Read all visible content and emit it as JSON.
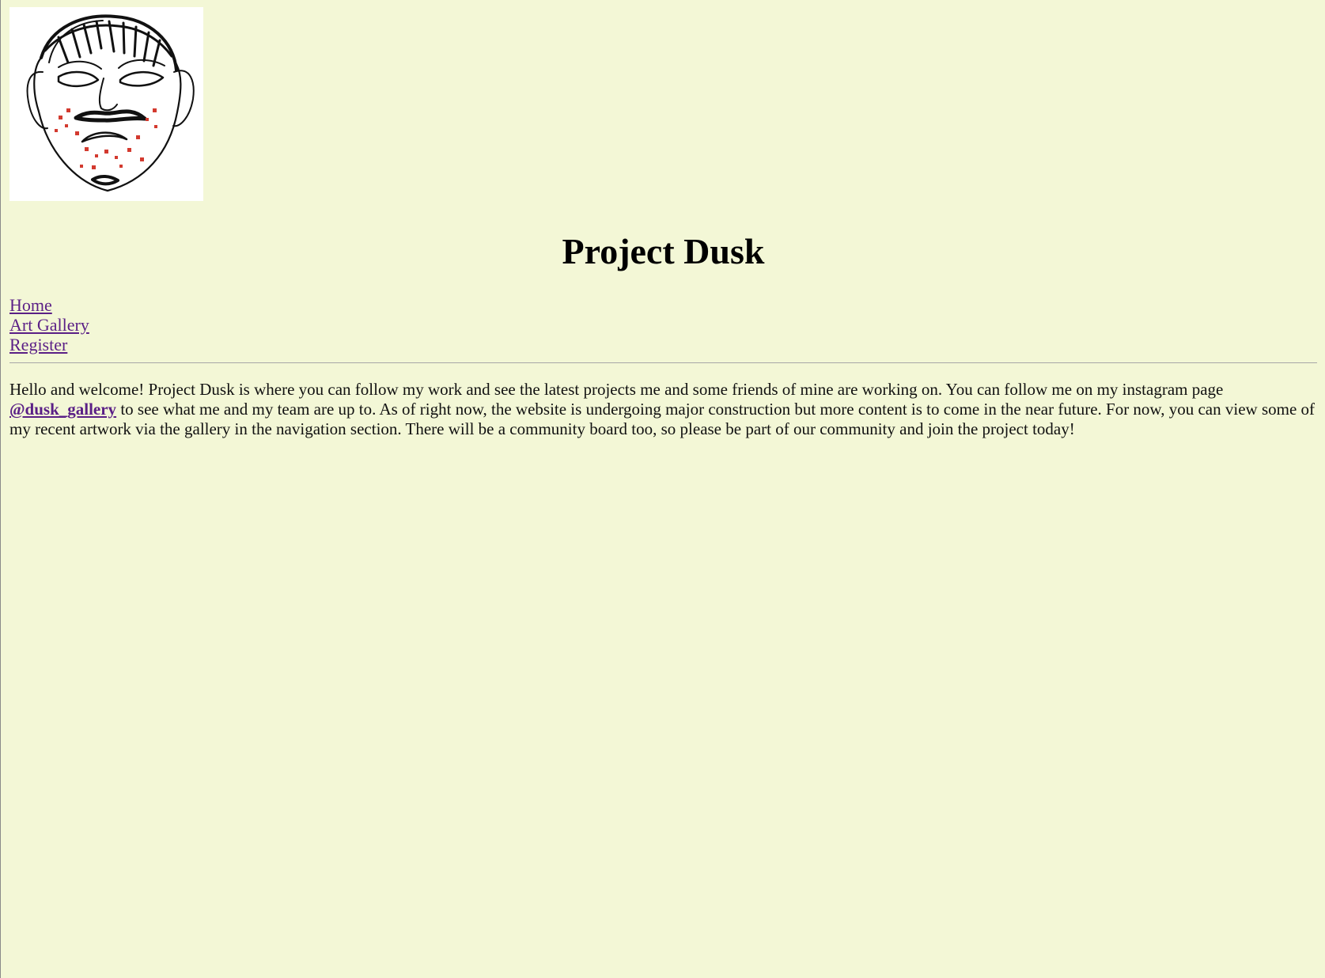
{
  "site": {
    "title": "Project Dusk",
    "logo_icon": "face-sketch-icon"
  },
  "navigation": {
    "items": [
      {
        "label": "Home"
      },
      {
        "label": "Art Gallery"
      },
      {
        "label": "Register"
      }
    ]
  },
  "main": {
    "intro_before_link": "Hello and welcome! Project Dusk is where you can follow my work and see the latest projects me and some friends of mine are working on. You can follow me on my instagram page ",
    "instagram_link": "@dusk_gallery",
    "intro_after_link": " to see what me and my team are up to. As of right now, the website is undergoing major construction but more content is to come in the near future. For now, you can view some of my recent artwork via the gallery in the navigation section. There will be a community board too, so please be part of our community and join the project today!"
  },
  "colors": {
    "background": "#f3f7d6",
    "link": "#5a1f86",
    "text": "#111111"
  }
}
